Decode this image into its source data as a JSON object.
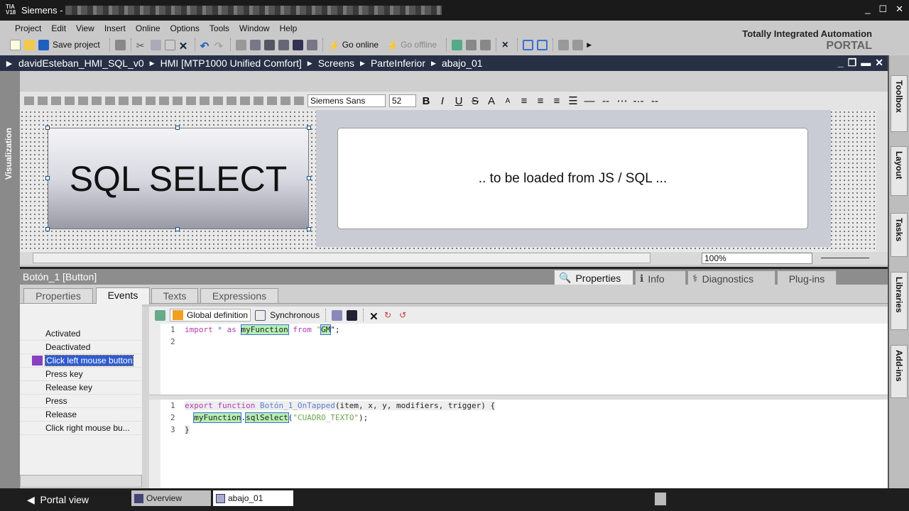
{
  "app": {
    "title": "Siemens -",
    "logo": "TIA V18",
    "brand_line1": "Totally Integrated Automation",
    "brand_line2": "PORTAL"
  },
  "menu": [
    "Project",
    "Edit",
    "View",
    "Insert",
    "Online",
    "Options",
    "Tools",
    "Window",
    "Help"
  ],
  "toolbar": {
    "save_label": "Save project",
    "go_online": "Go online",
    "go_offline": "Go offline"
  },
  "breadcrumb": [
    "davidEsteban_HMI_SQL_v0",
    "HMI [MTP1000 Unified Comfort]",
    "Screens",
    "ParteInferior",
    "abajo_01"
  ],
  "left_panel": "Visualization",
  "right_tabs": [
    "Toolbox",
    "Layout",
    "Tasks",
    "Libraries",
    "Add-ins"
  ],
  "format": {
    "font": "Siemens Sans",
    "size": "52"
  },
  "screen": {
    "button_text": "SQL SELECT",
    "textbox_text": ".. to be loaded from JS / SQL ..."
  },
  "zoom": "100%",
  "inspector": {
    "title": "Botón_1 [Button]",
    "tabs": [
      "Properties",
      "Info",
      "Diagnostics",
      "Plug-ins"
    ],
    "subtabs": [
      "Properties",
      "Events",
      "Texts",
      "Expressions"
    ]
  },
  "events": [
    "Activated",
    "Deactivated",
    "Click left mouse button",
    "Press key",
    "Release key",
    "Press",
    "Release",
    "Click right mouse bu..."
  ],
  "codebar": {
    "global": "Global definition",
    "sync": "Synchronous"
  },
  "code_global": {
    "l1": {
      "n": "1",
      "kw1": "import",
      "star": "*",
      "kw2": "as",
      "id": "myFunction",
      "kw3": "from",
      "q1": "\"",
      "mod": "GM",
      "q2": "\";"
    },
    "l2": {
      "n": "2"
    }
  },
  "code_event": {
    "l1": {
      "n": "1",
      "kw": "export function",
      "name": "Botón_1_OnTapped",
      "args": "(item, x, y, modifiers, trigger) {"
    },
    "l2": {
      "n": "2",
      "obj": "myFunction",
      "dot": ".",
      "m": "sqlSelect",
      "open": "(",
      "arg": "\"CUADRO_TEXTO\"",
      "close": ");"
    },
    "l3": {
      "n": "3",
      "b": "}"
    }
  },
  "bottom": {
    "portal": "Portal view",
    "tabs": [
      "Overview",
      "abajo_01"
    ]
  }
}
